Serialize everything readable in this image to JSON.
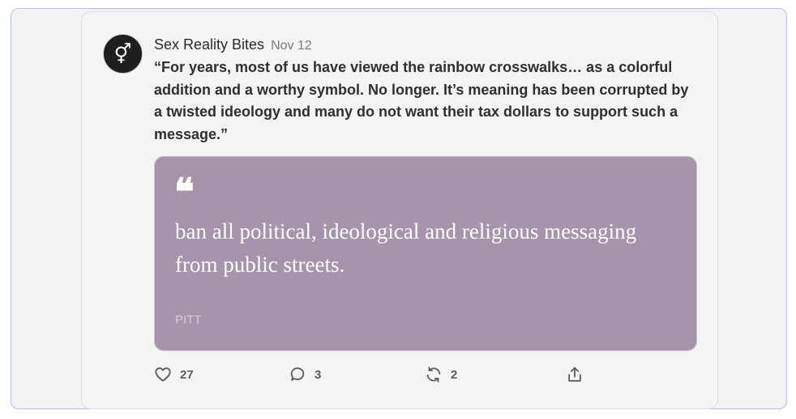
{
  "post": {
    "author": "Sex Reality Bites",
    "date": "Nov 12",
    "avatar_icon": "gender-symbol-icon",
    "avatar_glyph": "⚥",
    "body": "“For years, most of us have viewed the rainbow crosswalks… as a colorful addition and a worthy symbol. No longer. It’s meaning has been corrupted by a twisted ideology and many do not want their tax dollars to support such a message.”"
  },
  "quote": {
    "mark": "❝",
    "text": "ban all political, ideological and religious messaging from public streets.",
    "source": "PITT",
    "background_color": "#a595aa"
  },
  "actions": {
    "likes": {
      "icon": "heart-icon",
      "count": "27"
    },
    "comments": {
      "icon": "comment-icon",
      "count": "3"
    },
    "restacks": {
      "icon": "restack-icon",
      "count": "2"
    },
    "share": {
      "icon": "share-icon"
    }
  }
}
